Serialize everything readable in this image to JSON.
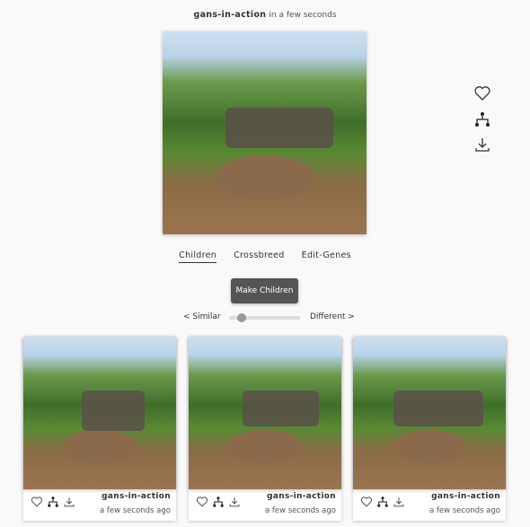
{
  "header": {
    "username": "gans-in-action",
    "time": "in a few seconds"
  },
  "main_image": {
    "alt": ""
  },
  "side_actions": [
    {
      "icon": "heart-icon"
    },
    {
      "icon": "family-tree-icon"
    },
    {
      "icon": "download-icon"
    }
  ],
  "tabs": [
    {
      "label": "Children",
      "active": true
    },
    {
      "label": "Crossbreed"
    },
    {
      "label": "Edit-Genes"
    }
  ],
  "make_children_label": "Make Children",
  "slider": {
    "left_label": "< Similar",
    "right_label": "Different >",
    "value_percent": 18
  },
  "children": [
    {
      "username": "gans-in-action",
      "time": "a few seconds ago"
    },
    {
      "username": "gans-in-action",
      "time": "a few seconds ago"
    },
    {
      "username": "gans-in-action",
      "time": "a few seconds ago"
    }
  ],
  "colors": {
    "button": "#555555",
    "accent": "#333333"
  }
}
